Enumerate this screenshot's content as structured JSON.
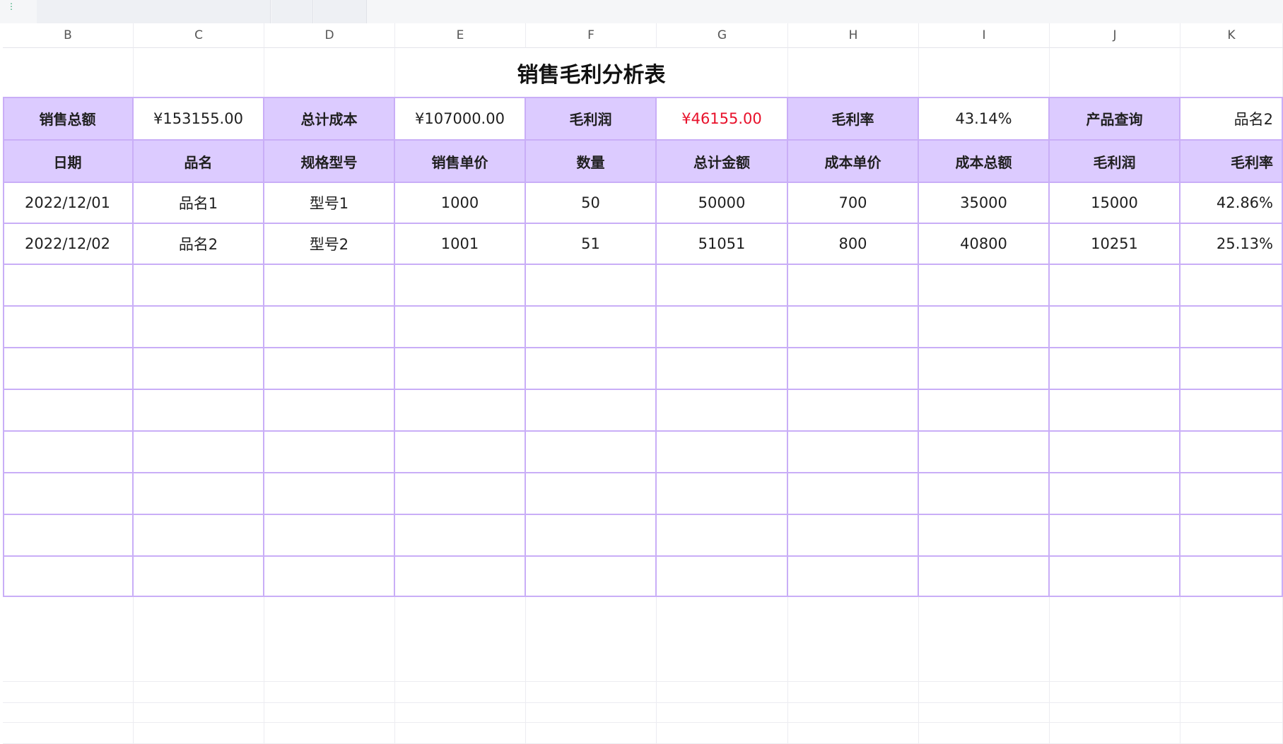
{
  "columns": [
    "B",
    "C",
    "D",
    "E",
    "F",
    "G",
    "H",
    "I",
    "J",
    "K"
  ],
  "title": "销售毛利分析表",
  "summary": {
    "sales_total_label": "销售总额",
    "sales_total_value": "¥153155.00",
    "cost_total_label": "总计成本",
    "cost_total_value": "¥107000.00",
    "gross_profit_label": "毛利润",
    "gross_profit_value": "¥46155.00",
    "margin_label": "毛利率",
    "margin_value": "43.14%",
    "query_label": "产品查询",
    "query_value": "品名2"
  },
  "table": {
    "headers": [
      "日期",
      "品名",
      "规格型号",
      "销售单价",
      "数量",
      "总计金额",
      "成本单价",
      "成本总额",
      "毛利润",
      "毛利率"
    ],
    "rows": [
      [
        "2022/12/01",
        "品名1",
        "型号1",
        "1000",
        "50",
        "50000",
        "700",
        "35000",
        "15000",
        "42.86%"
      ],
      [
        "2022/12/02",
        "品名2",
        "型号2",
        "1001",
        "51",
        "51051",
        "800",
        "40800",
        "10251",
        "25.13%"
      ]
    ]
  },
  "colors": {
    "header_fill": "#dccbff",
    "border": "#c9aef7",
    "negative_accent": "#e8102a"
  }
}
